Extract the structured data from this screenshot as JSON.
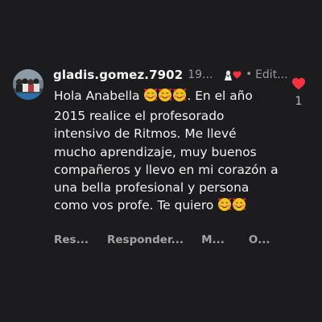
{
  "comment": {
    "username": "gladis.gomez.7902",
    "time": "19...",
    "edited_label": "Edit...",
    "text_part1": "Hola Anabella ",
    "text_part2": ". En el año 2015 realice el profesorado intensivo de Ritmos. Me llevé mucho aprendizaje, muy buenos compañeros y llevo en mi corazón a una bella profesional y persona como vos profe. Te quiero ",
    "emoji_name": "smiling-face-with-hearts-emoji",
    "like_count": "1"
  },
  "actions": {
    "item1": "Res...",
    "item2": "Responder...",
    "item3": "M...",
    "item4": "O..."
  },
  "colors": {
    "background": "#1c1c1e",
    "like_heart": "#ff3040",
    "text": "#f2f2f2",
    "muted": "#9a9a9a"
  }
}
